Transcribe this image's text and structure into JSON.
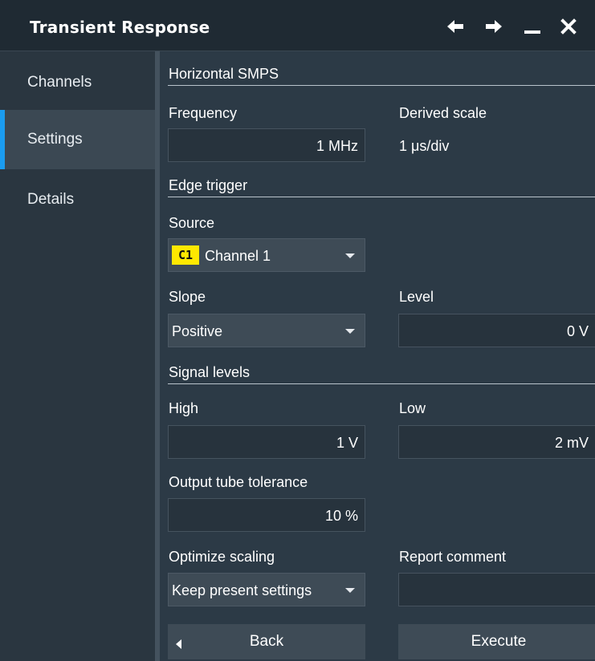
{
  "window": {
    "title": "Transient Response",
    "icons": [
      "arrow-left-icon",
      "arrow-right-icon",
      "minimize-icon",
      "close-icon"
    ]
  },
  "sidebar": {
    "items": [
      {
        "label": "Channels",
        "active": false
      },
      {
        "label": "Settings",
        "active": true
      },
      {
        "label": "Details",
        "active": false
      }
    ]
  },
  "horizontal": {
    "section_title": "Horizontal SMPS",
    "frequency_label": "Frequency",
    "frequency_value": "1 MHz",
    "derived_scale_label": "Derived scale",
    "derived_scale_value": "1 μs/div"
  },
  "trigger": {
    "section_title": "Edge trigger",
    "source_label": "Source",
    "source_badge": "C1",
    "source_value": "Channel 1",
    "slope_label": "Slope",
    "slope_value": "Positive",
    "level_label": "Level",
    "level_value": "0 V"
  },
  "signal": {
    "section_title": "Signal levels",
    "high_label": "High",
    "high_value": "1 V",
    "low_label": "Low",
    "low_value": "2 mV",
    "tolerance_label": "Output tube tolerance",
    "tolerance_value": "10 %",
    "optimize_label": "Optimize scaling",
    "optimize_value": "Keep present settings",
    "comment_label": "Report comment",
    "comment_value": ""
  },
  "buttons": {
    "back": "Back",
    "execute": "Execute"
  },
  "colors": {
    "accent": "#1a9cf0",
    "channel1": "#ffe800",
    "background": "#2c3a46"
  }
}
